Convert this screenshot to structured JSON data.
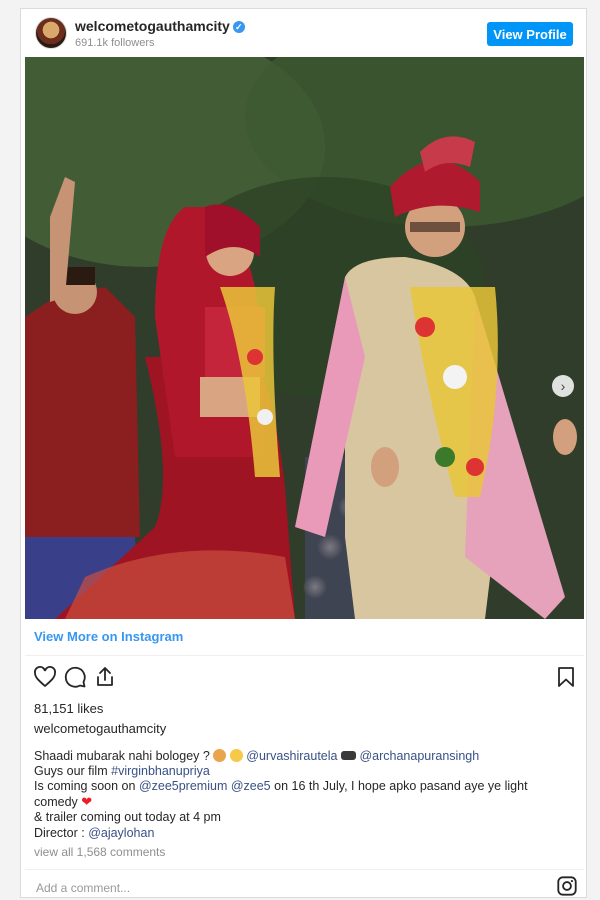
{
  "header": {
    "username": "welcometogauthamcity",
    "followers": "691.1k followers",
    "view_profile_label": "View Profile"
  },
  "post": {
    "view_more_label": "View More on Instagram",
    "likes": "81,151 likes",
    "caption_username": "welcometogauthamcity",
    "caption": {
      "line1_text": "Shaadi mubarak nahi bologey ?",
      "mention1": "@urvashirautela",
      "mention2": "@archanapuransingh",
      "line2_text": "Guys our film",
      "hashtag": "#virginbhanupriya",
      "line3_prefix": "Is coming soon on",
      "mention3": "@zee5premium",
      "mention4": "@zee5",
      "line3_suffix": "on 16 th July, I hope apko pasand aye ye light comedy",
      "line4": "& trailer coming out today at 4 pm",
      "director_label": "Director :",
      "director_mention": "@ajaylohan"
    },
    "comments_link": "view all 1,568 comments",
    "comment_placeholder": "Add a comment..."
  },
  "icons": {
    "verified": "verified-badge-icon",
    "like": "heart-outline-icon",
    "comment": "speech-bubble-icon",
    "share": "share-upload-icon",
    "save": "bookmark-icon",
    "instagram": "instagram-logo-icon",
    "carousel_next": "chevron-right-icon"
  },
  "colors": {
    "accent_blue": "#0095f6",
    "link_blue": "#3897f0",
    "mention_blue": "#385185",
    "muted_gray": "#8e8e8e"
  }
}
